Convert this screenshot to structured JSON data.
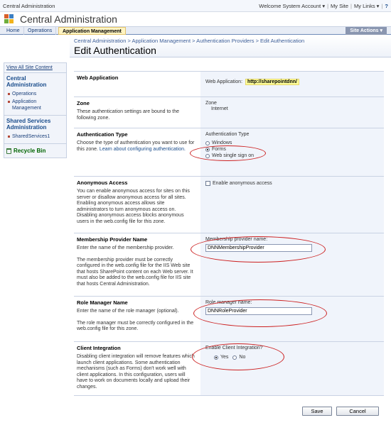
{
  "top": {
    "site_name": "Central Administration",
    "welcome": "Welcome System Account ▾",
    "my_site": "My Site",
    "my_links": "My Links ▾",
    "help": "?"
  },
  "header": {
    "title": "Central Administration"
  },
  "tabs": [
    {
      "label": "Home"
    },
    {
      "label": "Operations"
    },
    {
      "label": "Application Management"
    }
  ],
  "site_actions": "Site Actions ▾",
  "breadcrumb": "Central Administration > Application Management > Authentication Providers > Edit Authentication",
  "page_title": "Edit Authentication",
  "sidebar": {
    "view_all": "View All Site Content",
    "central_admin_heading": "Central Administration",
    "central_items": [
      "Operations",
      "Application Management"
    ],
    "ssp_heading": "Shared Services Administration",
    "ssp_items": [
      "SharedServices1"
    ],
    "recycle_bin": "Recycle Bin"
  },
  "sections": {
    "web_app": {
      "title": "Web Application",
      "label": "Web Application:",
      "value": "http://sharepointdnn/"
    },
    "zone": {
      "title": "Zone",
      "desc": "These authentication settings are bound to the following zone.",
      "label": "Zone",
      "value": "Internet"
    },
    "auth_type": {
      "title": "Authentication Type",
      "desc": "Choose the type of authentication you want to use for this zone.",
      "learn_more": "Learn about configuring authentication.",
      "label": "Authentication Type",
      "options": [
        "Windows",
        "Forms",
        "Web single sign on"
      ],
      "selected": "Forms"
    },
    "anonymous": {
      "title": "Anonymous Access",
      "desc": "You can enable anonymous access for sites on this server or disallow anonymous access for all sites. Enabling anonymous access allows site administrators to turn anonymous access on. Disabling anonymous access blocks anonymous users in the web.config file for this zone.",
      "checkbox_label": "Enable anonymous access"
    },
    "membership": {
      "title": "Membership Provider Name",
      "desc1": "Enter the name of the membership provider.",
      "desc2": "The membership provider must be correctly configured in the web.config file for the IIS Web site that hosts SharePoint content on each Web server. It must also be added to the web.config file for IIS site that hosts Central Administration.",
      "label": "Membership provider name:",
      "value": "DNNMembershipProvider"
    },
    "role": {
      "title": "Role Manager Name",
      "desc1": "Enter the name of the role manager (optional).",
      "desc2": "The role manager must be correctly configured in the web.config file for this zone.",
      "label": "Role manager name:",
      "value": "DNNRoleProvider"
    },
    "client": {
      "title": "Client Integration",
      "desc": "Disabling client integration will remove features which launch client applications. Some authentication mechanisms (such as Forms) don't work well with client applications. In this configuration, users will have to work on documents locally and upload their changes.",
      "label": "Enable Client Integration?",
      "yes": "Yes",
      "no": "No",
      "selected": "Yes"
    }
  },
  "buttons": {
    "save": "Save",
    "cancel": "Cancel"
  },
  "colors": {
    "highlight_ring": "#cc2020",
    "section_right_bg": "#f0f4fb",
    "active_tab": "#fff4c2"
  }
}
